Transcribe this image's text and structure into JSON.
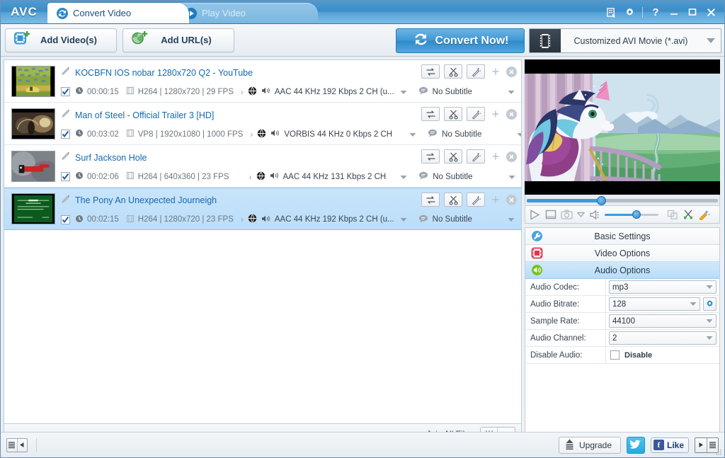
{
  "app": {
    "logo": "AVC",
    "tabs": [
      {
        "label": "Convert Video",
        "icon": "convert-icon",
        "active": true
      },
      {
        "label": "Play Video",
        "icon": "play-icon",
        "active": false
      }
    ],
    "window_controls": [
      {
        "name": "log-icon",
        "label": ""
      },
      {
        "name": "gear-icon",
        "label": ""
      },
      {
        "name": "help-icon",
        "label": "?"
      },
      {
        "name": "minimize-icon",
        "label": "—"
      },
      {
        "name": "maximize-icon",
        "label": "□"
      },
      {
        "name": "close-icon",
        "label": "✕"
      }
    ]
  },
  "toolbar": {
    "add_videos": "Add Video(s)",
    "add_urls": "Add URL(s)",
    "convert_now": "Convert Now!",
    "preset": "Customized AVI Movie (*.avi)",
    "accent": "#3e96d4"
  },
  "filelist": {
    "rows": [
      {
        "title": "KOCBFN IOS nobar 1280x720 Q2 - YouTube",
        "checked": true,
        "duration": "00:00:15",
        "video": "H264 | 1280x720 | 29 FPS",
        "audio": "AAC 44 KHz 192 Kbps 2 CH (u...",
        "subtitle": "No Subtitle",
        "selected": false,
        "thumb": "farm"
      },
      {
        "title": "Man of Steel - Official Trailer 3 [HD]",
        "checked": true,
        "duration": "00:03:02",
        "video": "VP8 | 1920x1080 | 1000 FPS",
        "audio": "VORBIS 44 KHz 0 Kbps 2 CH",
        "subtitle": "No Subtitle",
        "selected": false,
        "thumb": "steel"
      },
      {
        "title": "Surf Jackson Hole",
        "checked": true,
        "duration": "00:02:06",
        "video": "H264 | 640x360 | 23 FPS",
        "audio": "AAC 44 KHz 131 Kbps 2 CH",
        "subtitle": "No Subtitle",
        "selected": false,
        "thumb": "surf"
      },
      {
        "title": "The Pony An Unexpected Journeigh",
        "checked": true,
        "duration": "00:02:15",
        "video": "H264 | 1280x720 | 23 FPS",
        "audio": "AAC 44 KHz 192 Kbps 2 CH (u...",
        "subtitle": "No Subtitle",
        "selected": true,
        "thumb": "pony"
      }
    ],
    "row_actions": [
      "swap-icon",
      "scissors-icon",
      "magic-wand-icon"
    ],
    "join_all_files": "Join All Files",
    "join_toggle_state": "OFF"
  },
  "preview": {
    "seek_percent": 38,
    "volume_percent": 58,
    "controls": [
      "play-icon",
      "stop-icon",
      "snapshot-icon",
      "snapshot-dropdown-icon",
      "volume-icon",
      "volume-slider",
      "clone-icon",
      "cut-icon",
      "effect-icon"
    ]
  },
  "settings": {
    "sections": [
      {
        "label": "Basic Settings",
        "icon": "wrench-icon",
        "active": false
      },
      {
        "label": "Video Options",
        "icon": "video-icon",
        "active": false
      },
      {
        "label": "Audio Options",
        "icon": "audio-icon",
        "active": true
      }
    ],
    "audio_options": [
      {
        "label": "Audio Codec:",
        "value": "mp3",
        "gear": false
      },
      {
        "label": "Audio Bitrate:",
        "value": "128",
        "gear": true
      },
      {
        "label": "Sample Rate:",
        "value": "44100",
        "gear": false
      },
      {
        "label": "Audio Channel:",
        "value": "2",
        "gear": false
      }
    ],
    "disable_audio": {
      "label": "Disable Audio:",
      "checkbox_label": "Disable",
      "checked": false
    }
  },
  "footer": {
    "upgrade": "Upgrade",
    "twitter": "twitter-icon",
    "facebook_like": "Like",
    "facebook_f": "f"
  }
}
